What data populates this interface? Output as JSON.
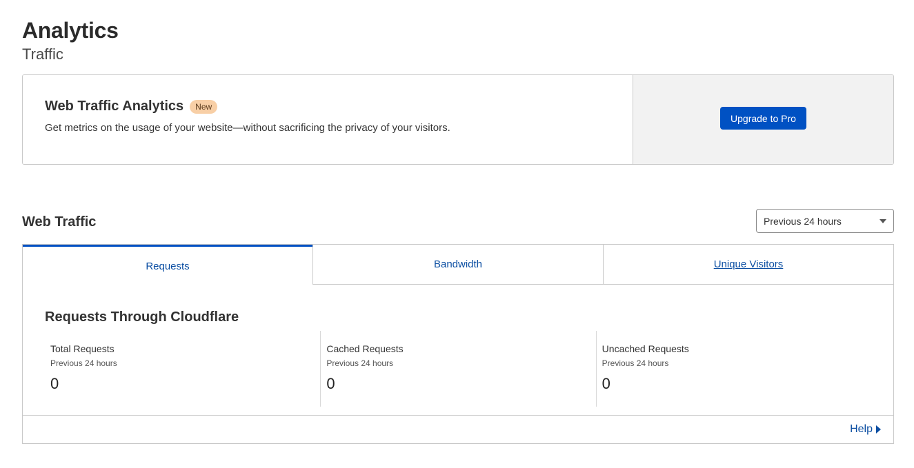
{
  "header": {
    "title": "Analytics",
    "subtitle": "Traffic"
  },
  "promo": {
    "title": "Web Traffic Analytics",
    "badge": "New",
    "description": "Get metrics on the usage of your website—without sacrificing the privacy of your visitors.",
    "button_label": "Upgrade to Pro"
  },
  "web_traffic": {
    "title": "Web Traffic",
    "time_range": {
      "selected": "Previous 24 hours"
    },
    "tabs": [
      {
        "label": "Requests",
        "active": true
      },
      {
        "label": "Bandwidth",
        "active": false
      },
      {
        "label": "Unique Visitors",
        "active": false
      }
    ],
    "panel": {
      "heading": "Requests Through Cloudflare",
      "metrics": [
        {
          "label": "Total Requests",
          "period": "Previous 24 hours",
          "value": "0"
        },
        {
          "label": "Cached Requests",
          "period": "Previous 24 hours",
          "value": "0"
        },
        {
          "label": "Uncached Requests",
          "period": "Previous 24 hours",
          "value": "0"
        }
      ]
    },
    "help_label": "Help"
  },
  "colors": {
    "accent": "#0051c3",
    "link": "#0b4ea2",
    "badge_bg": "#f8cfa6",
    "promo_side_bg": "#f2f2f2"
  }
}
